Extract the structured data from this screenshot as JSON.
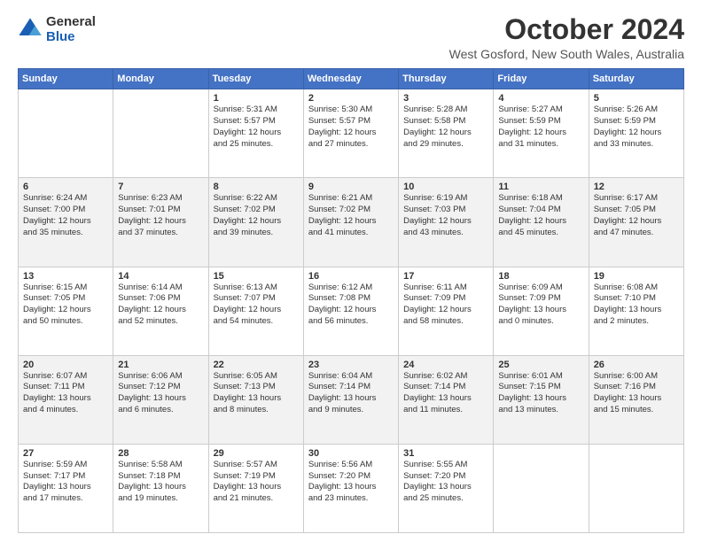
{
  "logo": {
    "line1": "General",
    "line2": "Blue"
  },
  "title": "October 2024",
  "subtitle": "West Gosford, New South Wales, Australia",
  "days_of_week": [
    "Sunday",
    "Monday",
    "Tuesday",
    "Wednesday",
    "Thursday",
    "Friday",
    "Saturday"
  ],
  "weeks": [
    [
      {
        "day": "",
        "content": ""
      },
      {
        "day": "",
        "content": ""
      },
      {
        "day": "1",
        "content": "Sunrise: 5:31 AM\nSunset: 5:57 PM\nDaylight: 12 hours\nand 25 minutes."
      },
      {
        "day": "2",
        "content": "Sunrise: 5:30 AM\nSunset: 5:57 PM\nDaylight: 12 hours\nand 27 minutes."
      },
      {
        "day": "3",
        "content": "Sunrise: 5:28 AM\nSunset: 5:58 PM\nDaylight: 12 hours\nand 29 minutes."
      },
      {
        "day": "4",
        "content": "Sunrise: 5:27 AM\nSunset: 5:59 PM\nDaylight: 12 hours\nand 31 minutes."
      },
      {
        "day": "5",
        "content": "Sunrise: 5:26 AM\nSunset: 5:59 PM\nDaylight: 12 hours\nand 33 minutes."
      }
    ],
    [
      {
        "day": "6",
        "content": "Sunrise: 6:24 AM\nSunset: 7:00 PM\nDaylight: 12 hours\nand 35 minutes."
      },
      {
        "day": "7",
        "content": "Sunrise: 6:23 AM\nSunset: 7:01 PM\nDaylight: 12 hours\nand 37 minutes."
      },
      {
        "day": "8",
        "content": "Sunrise: 6:22 AM\nSunset: 7:02 PM\nDaylight: 12 hours\nand 39 minutes."
      },
      {
        "day": "9",
        "content": "Sunrise: 6:21 AM\nSunset: 7:02 PM\nDaylight: 12 hours\nand 41 minutes."
      },
      {
        "day": "10",
        "content": "Sunrise: 6:19 AM\nSunset: 7:03 PM\nDaylight: 12 hours\nand 43 minutes."
      },
      {
        "day": "11",
        "content": "Sunrise: 6:18 AM\nSunset: 7:04 PM\nDaylight: 12 hours\nand 45 minutes."
      },
      {
        "day": "12",
        "content": "Sunrise: 6:17 AM\nSunset: 7:05 PM\nDaylight: 12 hours\nand 47 minutes."
      }
    ],
    [
      {
        "day": "13",
        "content": "Sunrise: 6:15 AM\nSunset: 7:05 PM\nDaylight: 12 hours\nand 50 minutes."
      },
      {
        "day": "14",
        "content": "Sunrise: 6:14 AM\nSunset: 7:06 PM\nDaylight: 12 hours\nand 52 minutes."
      },
      {
        "day": "15",
        "content": "Sunrise: 6:13 AM\nSunset: 7:07 PM\nDaylight: 12 hours\nand 54 minutes."
      },
      {
        "day": "16",
        "content": "Sunrise: 6:12 AM\nSunset: 7:08 PM\nDaylight: 12 hours\nand 56 minutes."
      },
      {
        "day": "17",
        "content": "Sunrise: 6:11 AM\nSunset: 7:09 PM\nDaylight: 12 hours\nand 58 minutes."
      },
      {
        "day": "18",
        "content": "Sunrise: 6:09 AM\nSunset: 7:09 PM\nDaylight: 13 hours\nand 0 minutes."
      },
      {
        "day": "19",
        "content": "Sunrise: 6:08 AM\nSunset: 7:10 PM\nDaylight: 13 hours\nand 2 minutes."
      }
    ],
    [
      {
        "day": "20",
        "content": "Sunrise: 6:07 AM\nSunset: 7:11 PM\nDaylight: 13 hours\nand 4 minutes."
      },
      {
        "day": "21",
        "content": "Sunrise: 6:06 AM\nSunset: 7:12 PM\nDaylight: 13 hours\nand 6 minutes."
      },
      {
        "day": "22",
        "content": "Sunrise: 6:05 AM\nSunset: 7:13 PM\nDaylight: 13 hours\nand 8 minutes."
      },
      {
        "day": "23",
        "content": "Sunrise: 6:04 AM\nSunset: 7:14 PM\nDaylight: 13 hours\nand 9 minutes."
      },
      {
        "day": "24",
        "content": "Sunrise: 6:02 AM\nSunset: 7:14 PM\nDaylight: 13 hours\nand 11 minutes."
      },
      {
        "day": "25",
        "content": "Sunrise: 6:01 AM\nSunset: 7:15 PM\nDaylight: 13 hours\nand 13 minutes."
      },
      {
        "day": "26",
        "content": "Sunrise: 6:00 AM\nSunset: 7:16 PM\nDaylight: 13 hours\nand 15 minutes."
      }
    ],
    [
      {
        "day": "27",
        "content": "Sunrise: 5:59 AM\nSunset: 7:17 PM\nDaylight: 13 hours\nand 17 minutes."
      },
      {
        "day": "28",
        "content": "Sunrise: 5:58 AM\nSunset: 7:18 PM\nDaylight: 13 hours\nand 19 minutes."
      },
      {
        "day": "29",
        "content": "Sunrise: 5:57 AM\nSunset: 7:19 PM\nDaylight: 13 hours\nand 21 minutes."
      },
      {
        "day": "30",
        "content": "Sunrise: 5:56 AM\nSunset: 7:20 PM\nDaylight: 13 hours\nand 23 minutes."
      },
      {
        "day": "31",
        "content": "Sunrise: 5:55 AM\nSunset: 7:20 PM\nDaylight: 13 hours\nand 25 minutes."
      },
      {
        "day": "",
        "content": ""
      },
      {
        "day": "",
        "content": ""
      }
    ]
  ]
}
